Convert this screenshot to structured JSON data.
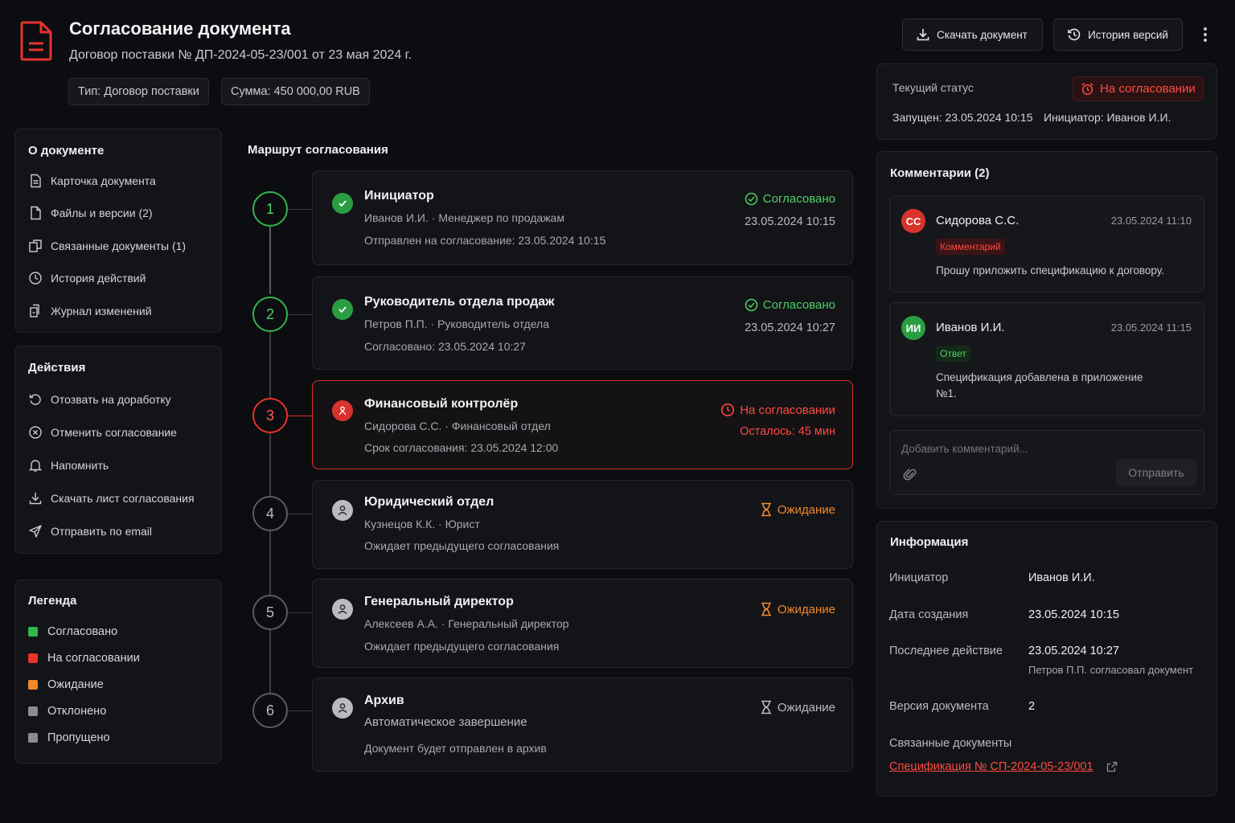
{
  "header": {
    "title": "Согласование документа",
    "subtitle": "Договор поставки № ДП-2024-05-23/001 от 23 мая 2024 г.",
    "chips": [
      "Тип: Договор поставки",
      "Сумма: 450 000,00 RUB"
    ],
    "download_label": "Скачать документ",
    "history_label": "История версий"
  },
  "sidebar": {
    "about_title": "О документе",
    "about_items": [
      {
        "label": "Карточка документа",
        "icon": "document-card-icon"
      },
      {
        "label": "Файлы и версии (2)",
        "icon": "file-icon"
      },
      {
        "label": "Связанные документы (1)",
        "icon": "linked-docs-icon"
      },
      {
        "label": "История действий",
        "icon": "clock-icon"
      },
      {
        "label": "Журнал изменений",
        "icon": "changelog-icon"
      }
    ],
    "actions_title": "Действия",
    "action_items": [
      {
        "label": "Отозвать на доработку",
        "icon": "undo-icon"
      },
      {
        "label": "Отменить согласование",
        "icon": "cancel-circle-icon"
      },
      {
        "label": "Напомнить",
        "icon": "bell-icon"
      },
      {
        "label": "Скачать лист согласования",
        "icon": "download-icon"
      },
      {
        "label": "Отправить по email",
        "icon": "send-icon"
      }
    ],
    "legend_title": "Легенда",
    "legend": [
      {
        "label": "Согласовано",
        "color": "#2fb84a"
      },
      {
        "label": "На согласовании",
        "color": "#e5322d"
      },
      {
        "label": "Ожидание",
        "color": "#f08a24"
      },
      {
        "label": "Отклонено",
        "color": "#8a8c92"
      },
      {
        "label": "Пропущено",
        "color": "#8a8c92"
      }
    ]
  },
  "route": {
    "title": "Маршрут согласования",
    "steps": [
      {
        "num": "1",
        "name": "Инициатор",
        "who": "Иванов И.И.  ·  Менеджер по продажам",
        "note": "Отправлен на согласование: 23.05.2024 10:15",
        "status": "Согласовано",
        "time": "23.05.2024 10:15"
      },
      {
        "num": "2",
        "name": "Руководитель отдела продаж",
        "who": "Петров П.П.  ·  Руководитель отдела",
        "note": "Согласовано: 23.05.2024 10:27",
        "status": "Согласовано",
        "time": "23.05.2024 10:27"
      },
      {
        "num": "3",
        "name": "Финансовый контролёр",
        "who": "Сидорова С.С.  ·  Финансовый отдел",
        "note": "Срок согласования: 23.05.2024 12:00",
        "status": "На согласовании",
        "time": "Осталось: 45 мин"
      },
      {
        "num": "4",
        "name": "Юридический отдел",
        "who": "Кузнецов К.К.  ·  Юрист",
        "note": "Ожидает предыдущего согласования",
        "status": "Ожидание"
      },
      {
        "num": "5",
        "name": "Генеральный директор",
        "who": "Алексеев А.А.  ·  Генеральный директор",
        "note": "Ожидает предыдущего согласования",
        "status": "Ожидание"
      },
      {
        "num": "6",
        "name": "Архив",
        "who": "Автоматическое завершение",
        "note": "Документ будет отправлен в архив",
        "status": "Ожидание"
      }
    ]
  },
  "status_panel": {
    "label": "Текущий статус",
    "badge": "На согласовании",
    "started": "Запущен: 23.05.2024 10:15",
    "initiator": "Инициатор: Иванов И.И."
  },
  "comments": {
    "title": "Комментарии (2)",
    "items": [
      {
        "initials": "СС",
        "name": "Сидорова С.С.",
        "time": "23.05.2024 11:10",
        "tag": "Комментарий",
        "text": "Прошу приложить спецификацию к договору."
      },
      {
        "initials": "ИИ",
        "name": "Иванов И.И.",
        "time": "23.05.2024 11:15",
        "tag": "Ответ",
        "text": "Спецификация добавлена в приложение №1."
      }
    ],
    "placeholder": "Добавить комментарий...",
    "send_label": "Отправить"
  },
  "info": {
    "title": "Информация",
    "rows": [
      {
        "key": "Инициатор",
        "value": "Иванов И.И."
      },
      {
        "key": "Дата создания",
        "value": "23.05.2024 10:15"
      },
      {
        "key": "Последнее действие",
        "value": "23.05.2024 10:27",
        "sub": "Петров П.П. согласовал документ"
      },
      {
        "key": "Версия документа",
        "value": "2"
      }
    ],
    "linked_label": "Связанные документы",
    "linked_doc": "Спецификация № СП-2024-05-23/001"
  },
  "colors": {
    "accent": "#e5322d",
    "ok": "#34b34d",
    "wait": "#f0892a"
  }
}
